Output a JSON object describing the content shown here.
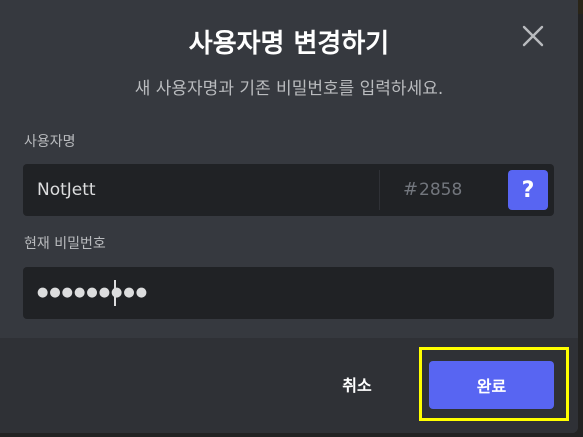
{
  "dialog": {
    "title": "사용자명 변경하기",
    "subtitle": "새 사용자명과 기존 비밀번호를 입력하세요.",
    "close_icon": "close-icon"
  },
  "username": {
    "label": "사용자명",
    "value": "NotJett",
    "discriminator_hash": "#",
    "discriminator": "2858",
    "help_label": "?"
  },
  "password": {
    "label": "현재 비밀번호",
    "masked_value": "●●●●●●●●●"
  },
  "footer": {
    "cancel_label": "취소",
    "done_label": "완료"
  },
  "colors": {
    "accent": "#5865f2",
    "highlight": "#ffff00",
    "modal_bg": "#36393f",
    "footer_bg": "#2f3136",
    "input_bg": "#202225"
  }
}
